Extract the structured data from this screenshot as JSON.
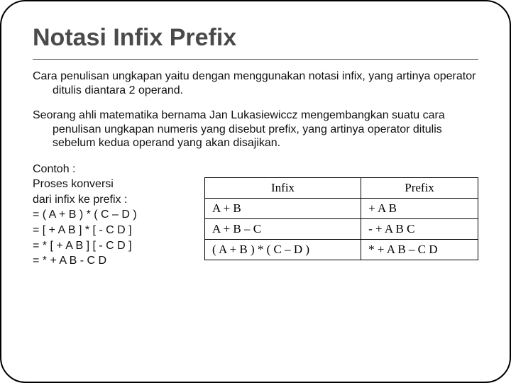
{
  "title": "Notasi Infix Prefix",
  "para1": "Cara penulisan ungkapan yaitu dengan menggunakan notasi infix, yang artinya operator ditulis diantara 2 operand.",
  "para2": "Seorang ahli matematika bernama Jan Lukasiewiccz mengembangkan suatu cara penulisan ungkapan numeris yang disebut prefix, yang artinya operator ditulis sebelum kedua operand yang akan disajikan.",
  "left": {
    "l1": "Contoh :",
    "l2": "Proses konversi",
    "l3": "dari infix ke prefix :",
    "l4": "= ( A + B ) * ( C – D )",
    "l5": "= [ + A B ] * [ - C D ]",
    "l6": "= * [ + A B ] [ - C D ]",
    "l7": "= * + A B - C D"
  },
  "table": {
    "h1": "Infix",
    "h2": "Prefix",
    "r1c1": "A + B",
    "r1c2": "+ A B",
    "r2c1": "A + B – C",
    "r2c2": "- + A B C",
    "r3c1": "( A + B ) * ( C – D )",
    "r3c2": "* + A B – C D"
  },
  "chart_data": {
    "type": "table",
    "columns": [
      "Infix",
      "Prefix"
    ],
    "rows": [
      [
        "A + B",
        "+ A B"
      ],
      [
        "A + B – C",
        "- + A B C"
      ],
      [
        "( A + B ) * ( C – D )",
        "* + A B – C D"
      ]
    ]
  }
}
